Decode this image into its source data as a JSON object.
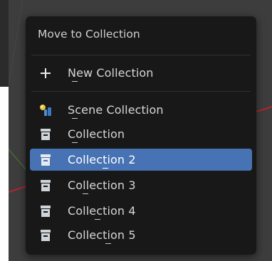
{
  "menu": {
    "title": "Move to Collection",
    "new_collection": {
      "label": "New Collection",
      "icon": "plus-icon"
    },
    "items": [
      {
        "label": "Scene Collection",
        "icon": "scene-collection-icon",
        "active": false
      },
      {
        "label": "Collection",
        "icon": "collection-box-icon",
        "active": false
      },
      {
        "label": "Collection 2",
        "icon": "collection-box-icon",
        "active": true
      },
      {
        "label": "Collection 3",
        "icon": "collection-box-icon",
        "active": false
      },
      {
        "label": "Collection 4",
        "icon": "collection-box-icon",
        "active": false
      },
      {
        "label": "Collection 5",
        "icon": "collection-box-icon",
        "active": false
      }
    ]
  },
  "colors": {
    "menu_bg": "#181818",
    "highlight": "#4772b3",
    "viewport_bg": "#3d3d3d",
    "axis_x": "#c0262a"
  }
}
